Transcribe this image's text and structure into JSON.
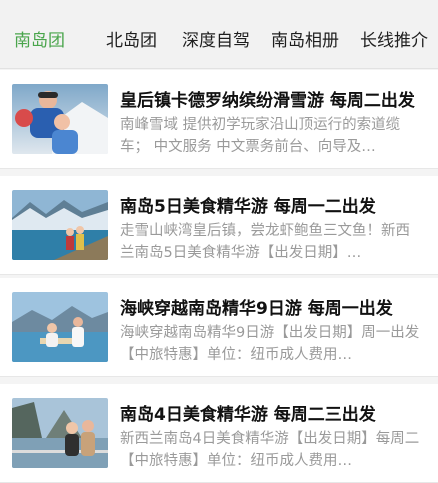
{
  "tabs": [
    {
      "label": "南岛团",
      "active": true
    },
    {
      "label": "北岛团",
      "active": false
    },
    {
      "label": "深度自驾",
      "active": false
    },
    {
      "label": "南岛相册",
      "active": false
    },
    {
      "label": "长线推介",
      "active": false
    }
  ],
  "colors": {
    "accent": "#4aa54c"
  },
  "items": [
    {
      "title": "皇后镇卡德罗纳缤纷滑雪游 每周二出发",
      "desc": "南峰雪域 提供初学玩家沿山顶运行的索道缆车； 中文服务 中文票务前台、向导及…"
    },
    {
      "title": "南岛5日美食精华游 每周一二出发",
      "desc": "走雪山峡湾皇后镇，尝龙虾鲍鱼三文鱼！新西兰南岛5日美食精华游【出发日期】…"
    },
    {
      "title": "海峡穿越南岛精华9日游 每周一出发",
      "desc": "海峡穿越南岛精华9日游【出发日期】周一出发【中旅特惠】单位：纽币成人费用…"
    },
    {
      "title": "南岛4日美食精华游 每周二三出发",
      "desc": "新西兰南岛4日美食精华游【出发日期】每周二【中旅特惠】单位：纽币成人费用…"
    }
  ]
}
